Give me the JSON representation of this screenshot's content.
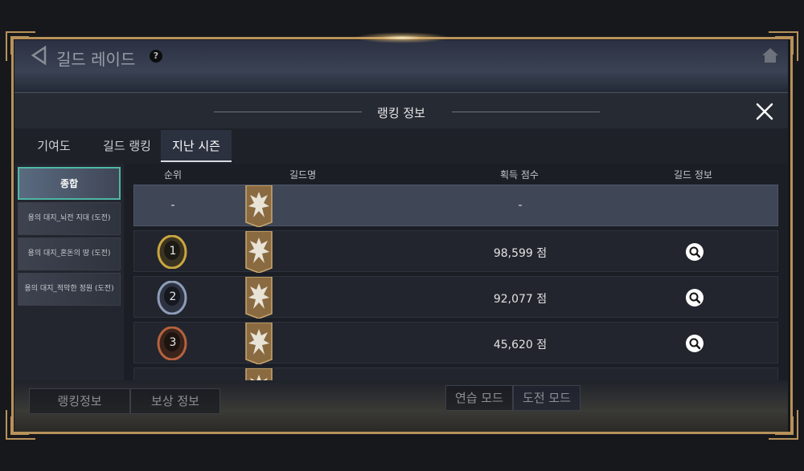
{
  "background": {
    "title": "길드 레이드",
    "help_label": "?",
    "bottom_buttons": [
      "랭킹정보",
      "보상 정보",
      "연습 모드",
      "도전 모드"
    ]
  },
  "modal": {
    "title": "랭킹 정보",
    "tabs": [
      "기여도",
      "길드 랭킹",
      "지난 시즌"
    ],
    "active_tab": "지난 시즌",
    "sidebar": [
      {
        "label": "종합",
        "active": true
      },
      {
        "label": "용의 대지_뇌전 지대 (도전)",
        "active": false
      },
      {
        "label": "용의 대지_혼돈의 땅 (도전)",
        "active": false
      },
      {
        "label": "용의 대지_적막한 정원 (도전)",
        "active": false
      }
    ],
    "columns": [
      "순위",
      "길드명",
      "획득 점수",
      "길드 정보"
    ],
    "my_row": {
      "rank": "-",
      "score": "-"
    },
    "rows": [
      {
        "rank": "1",
        "medal": "gold",
        "score": "98,599 점"
      },
      {
        "rank": "2",
        "medal": "silver",
        "score": "92,077 점"
      },
      {
        "rank": "3",
        "medal": "bronze",
        "score": "45,620 점"
      }
    ]
  },
  "colors": {
    "frame_gold": "#b8925a",
    "active_side_border": "#4fb7a5",
    "medal_gold": "#c9a640",
    "medal_silver": "#8e9cb8",
    "medal_bronze": "#b5623e"
  },
  "icons": [
    "back-arrow-icon",
    "help-icon",
    "home-icon",
    "close-icon",
    "guild-emblem-icon",
    "magnifier-icon",
    "rank-medal-icon"
  ]
}
